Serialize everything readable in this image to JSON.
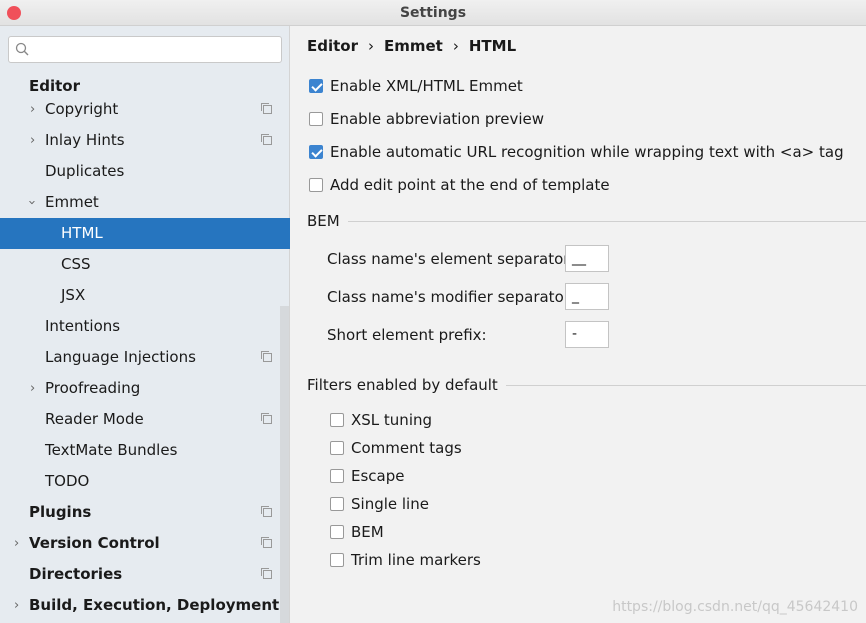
{
  "window": {
    "title": "Settings"
  },
  "search": {
    "placeholder": ""
  },
  "sidebar": {
    "items": [
      {
        "label": "Editor",
        "bold": true
      },
      {
        "label": "Copyright"
      },
      {
        "label": "Inlay Hints"
      },
      {
        "label": "Duplicates"
      },
      {
        "label": "Emmet"
      },
      {
        "label": "HTML"
      },
      {
        "label": "CSS"
      },
      {
        "label": "JSX"
      },
      {
        "label": "Intentions"
      },
      {
        "label": "Language Injections"
      },
      {
        "label": "Proofreading"
      },
      {
        "label": "Reader Mode"
      },
      {
        "label": "TextMate Bundles"
      },
      {
        "label": "TODO"
      },
      {
        "label": "Plugins"
      },
      {
        "label": "Version Control"
      },
      {
        "label": "Directories"
      },
      {
        "label": "Build, Execution, Deployment"
      }
    ]
  },
  "breadcrumb": [
    "Editor",
    "Emmet",
    "HTML"
  ],
  "options": [
    {
      "label": "Enable XML/HTML Emmet",
      "checked": true
    },
    {
      "label": "Enable abbreviation preview",
      "checked": false
    },
    {
      "label": "Enable automatic URL recognition while wrapping text with <a> tag",
      "checked": true
    },
    {
      "label": "Add edit point at the end of template",
      "checked": false
    }
  ],
  "bem": {
    "title": "BEM",
    "fields": [
      {
        "label": "Class name's element separator:",
        "value": "__"
      },
      {
        "label": "Class name's modifier separator:",
        "value": "_"
      },
      {
        "label": "Short element prefix:",
        "value": "-"
      }
    ]
  },
  "filters": {
    "title": "Filters enabled by default",
    "items": [
      {
        "label": "XSL tuning",
        "checked": false
      },
      {
        "label": "Comment tags",
        "checked": false
      },
      {
        "label": "Escape",
        "checked": false
      },
      {
        "label": "Single line",
        "checked": false
      },
      {
        "label": "BEM",
        "checked": false
      },
      {
        "label": "Trim line markers",
        "checked": false
      }
    ]
  },
  "watermark": "https://blog.csdn.net/qq_45642410",
  "colors": {
    "selection": "#2675bf",
    "checkbox": "#3c84d0"
  }
}
